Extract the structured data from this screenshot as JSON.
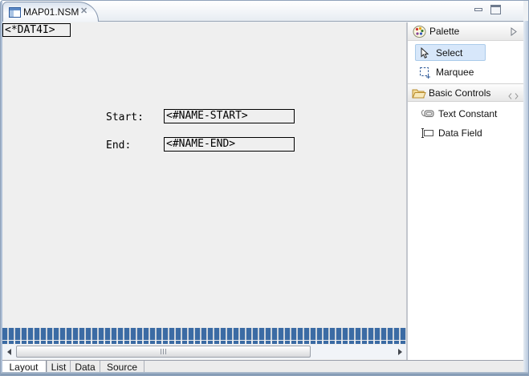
{
  "window": {
    "title": "MAP01.NSM"
  },
  "icons": {
    "close": "✕",
    "tab": "map-editor-icon",
    "minimize": "minimize-icon",
    "maximize": "maximize-icon",
    "palette": "palette-icon",
    "select_tool": "cursor-arrow-icon",
    "marquee_tool": "marquee-rect-icon",
    "basic_controls": "open-folder-icon",
    "pin": "pin-chevrons-icon",
    "expand": "right-triangle-icon",
    "text_constant": "label-icon",
    "data_field": "text-field-icon"
  },
  "canvas": {
    "system_var": "<*DAT4I>",
    "fields": [
      {
        "label": "Start:",
        "value": "<#NAME-START>"
      },
      {
        "label": "End:",
        "value": "<#NAME-END>"
      }
    ]
  },
  "palette": {
    "title": "Palette",
    "tools": [
      {
        "label": "Select",
        "selected": true
      },
      {
        "label": "Marquee",
        "selected": false
      }
    ],
    "section": {
      "title": "Basic Controls",
      "items": [
        {
          "label": "Text Constant"
        },
        {
          "label": "Data Field"
        }
      ]
    }
  },
  "bottom_tabs": [
    {
      "label": "Layout",
      "active": true
    },
    {
      "label": "List",
      "active": false
    },
    {
      "label": "Data",
      "active": false
    },
    {
      "label": "Source",
      "active": false
    }
  ],
  "colors": {
    "stripe_blue": "#3b6ba4",
    "selection_highlight": "#d7e7fa",
    "frame_border": "#8fa2ba"
  }
}
